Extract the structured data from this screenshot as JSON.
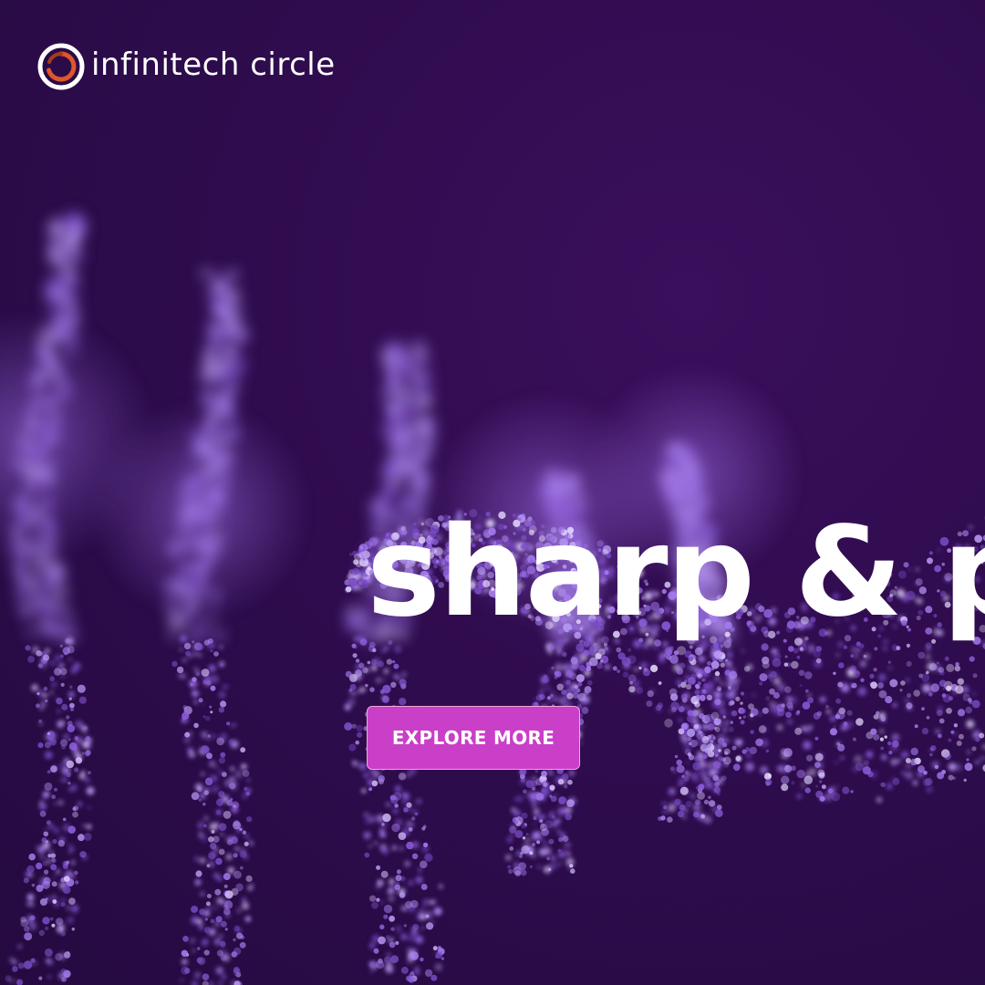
{
  "brand": {
    "name": "infinitech circle",
    "icon": "ring-logo-icon",
    "colors": {
      "ring_outer": "#ffffff",
      "ring_inner": "#e0562b"
    }
  },
  "hero": {
    "headline": "sharp & p",
    "cta_label": "EXPLORE MORE",
    "background_color": "#2e0c4c",
    "particle_color": "#8a5ad8",
    "cta_color": "#c93fc8"
  }
}
